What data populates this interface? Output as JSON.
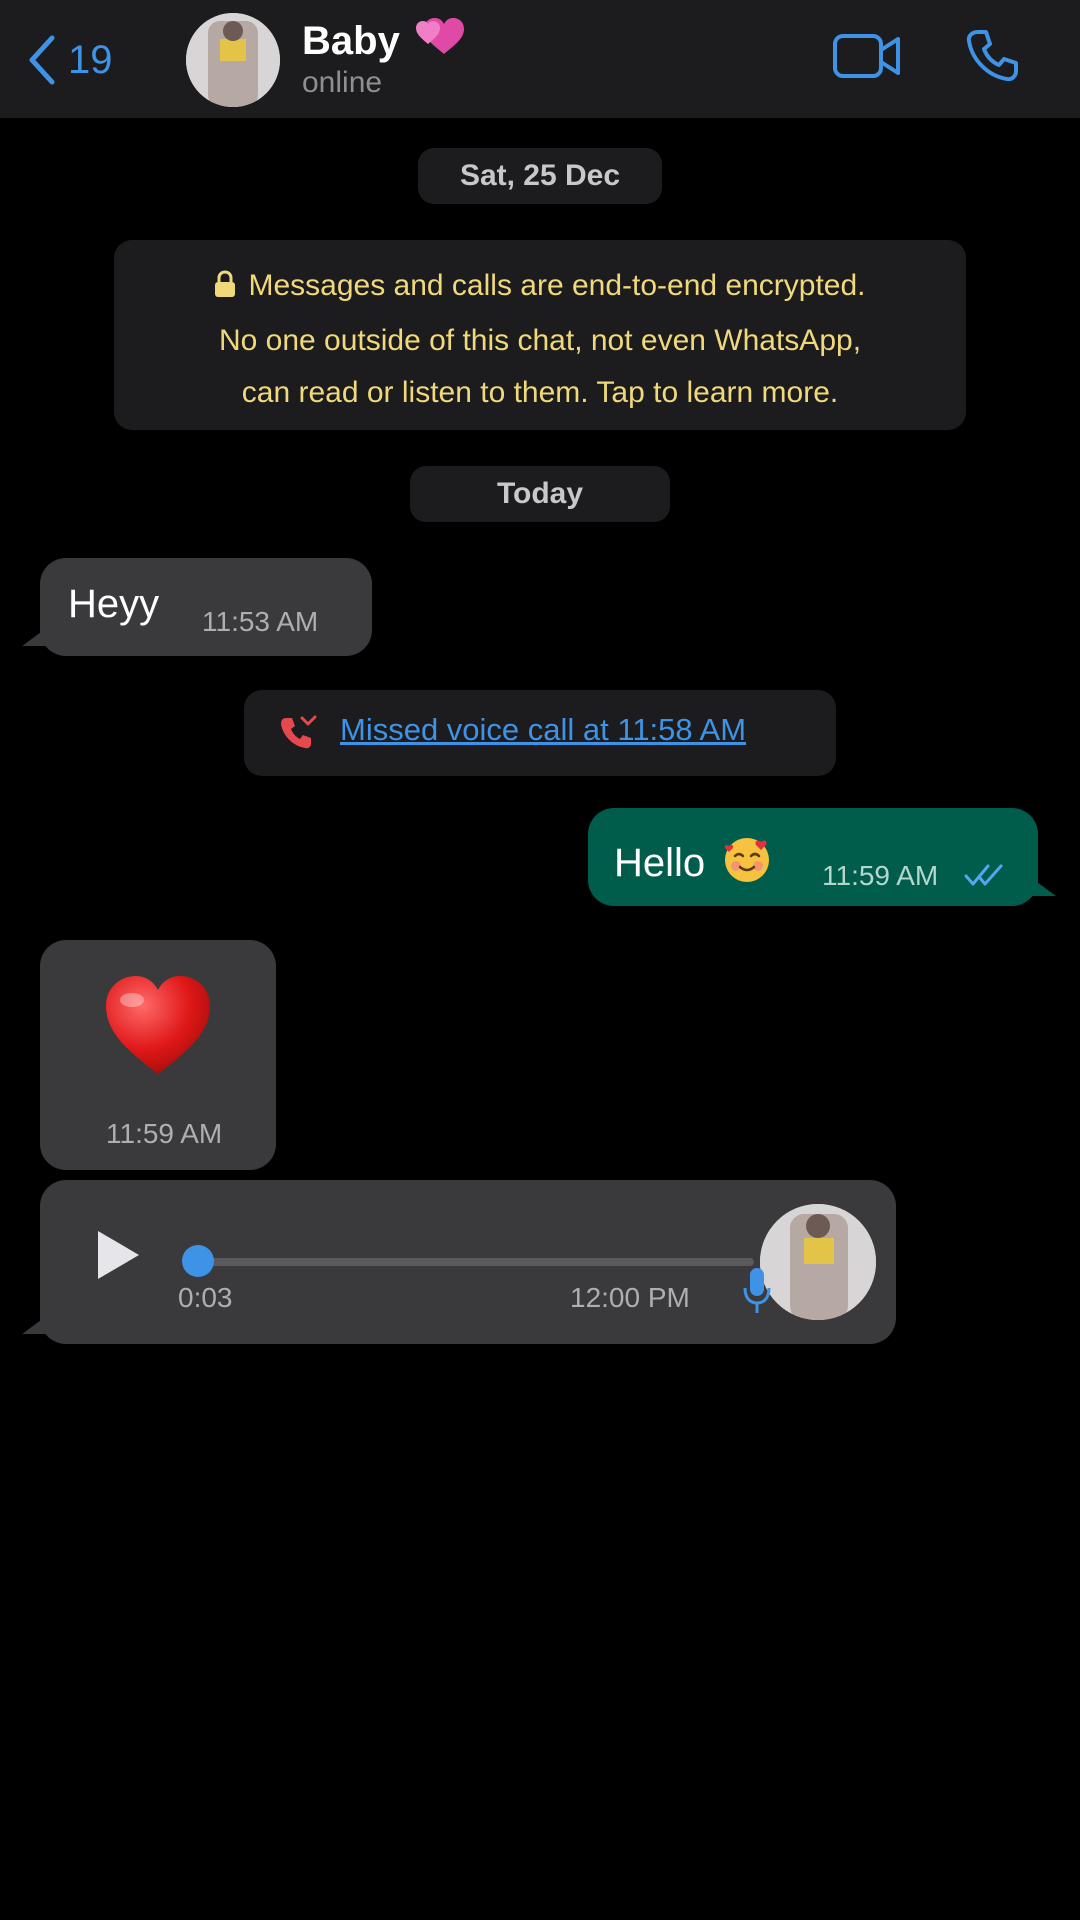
{
  "header": {
    "back_count": "19",
    "contact_name": "Baby",
    "contact_status": "online",
    "icons": {
      "back": "chevron-left-icon",
      "name_emoji": "two-hearts-icon",
      "video": "video-camera-icon",
      "call": "phone-icon"
    }
  },
  "chat": {
    "date_separator_1": "Sat, 25 Dec",
    "encryption_notice": {
      "line1": "Messages and calls are end-to-end encrypted.",
      "line2": "No one outside of this chat, not even WhatsApp,",
      "line3": "can read or listen to them. Tap to learn more.",
      "icon": "lock-icon"
    },
    "date_separator_2": "Today",
    "messages": [
      {
        "direction": "incoming",
        "text": "Heyy",
        "time": "11:53 AM"
      },
      {
        "type": "missed_call",
        "text": "Missed voice call at 11:58 AM",
        "icon": "missed-call-icon"
      },
      {
        "direction": "outgoing",
        "text": "Hello",
        "emoji": "smiling-face-with-hearts-icon",
        "time": "11:59 AM",
        "status": "read"
      },
      {
        "direction": "incoming",
        "emoji": "red-heart-icon",
        "time": "11:59 AM"
      },
      {
        "direction": "incoming",
        "type": "voice",
        "duration": "0:03",
        "time": "12:00 PM",
        "progress": 0.0
      }
    ]
  },
  "colors": {
    "background": "#000000",
    "header": "#1c1c1e",
    "accent_blue": "#3e93e6",
    "incoming_bubble": "#3a3a3c",
    "outgoing_bubble": "#005c4b",
    "encryption_text": "#f0d97a",
    "missed_call_red": "#e5484d"
  }
}
